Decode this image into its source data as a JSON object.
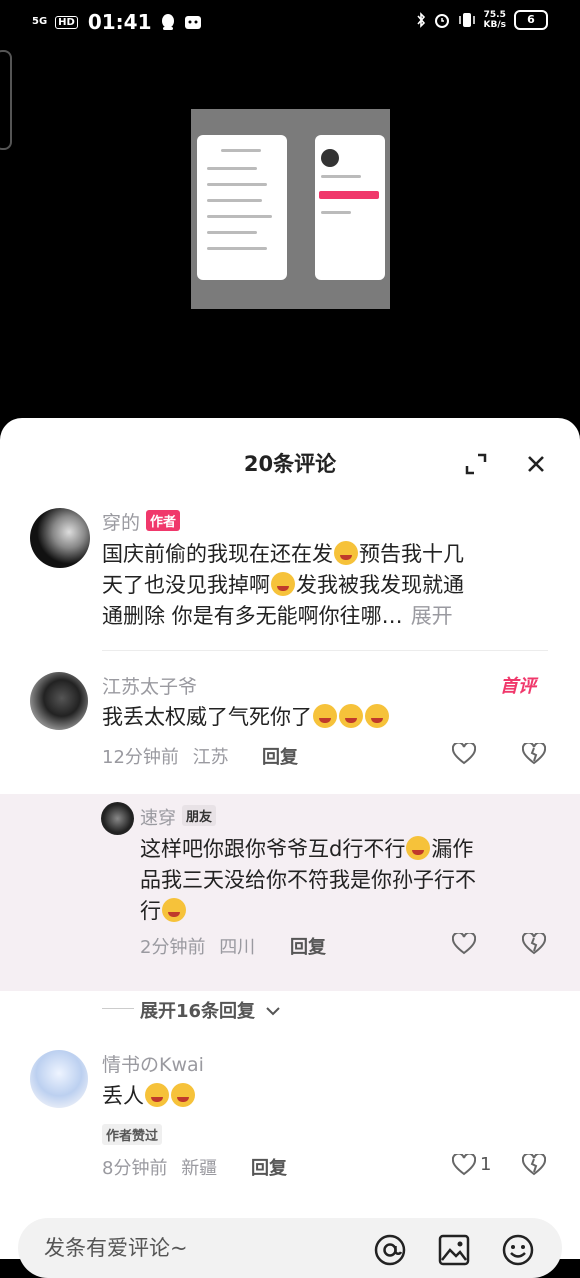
{
  "status_bar": {
    "network": "5G",
    "hd": "HD",
    "time": "01:41",
    "speed_value": "75.5",
    "speed_unit": "KB/s",
    "battery": "6"
  },
  "sheet": {
    "title": "20条评论"
  },
  "comments": [
    {
      "user": "穿的",
      "badge": "作者",
      "lines": [
        "国庆前偷的我现在还在发",
        "预告我十几",
        "天了也没见我掉啊",
        "发我被我发现就通",
        "通删除 你是有多无能啊你往哪…"
      ],
      "expand_label": "展开"
    },
    {
      "user": "江苏太子爷",
      "badge": "首评",
      "text": "我丢太权威了气死你了",
      "time": "12分钟前",
      "location": "江苏",
      "reply_label": "回复"
    },
    {
      "user": "速穿",
      "badge": "朋友",
      "lines": [
        "这样吧你跟你爷爷互d行不行",
        "漏作",
        "品我三天没给你不符我是你孙子行不",
        "行"
      ],
      "time": "2分钟前",
      "location": "四川",
      "reply_label": "回复"
    },
    {
      "user": "情书のKwai",
      "text": "丢人",
      "badge": "作者赞过",
      "time": "8分钟前",
      "location": "新疆",
      "reply_label": "回复",
      "likes": "1"
    }
  ],
  "expand_replies": "展开16条回复",
  "input": {
    "placeholder": "发条有爱评论~"
  },
  "colors": {
    "accent": "#f0386b",
    "reply_bg": "#f5eff3"
  }
}
